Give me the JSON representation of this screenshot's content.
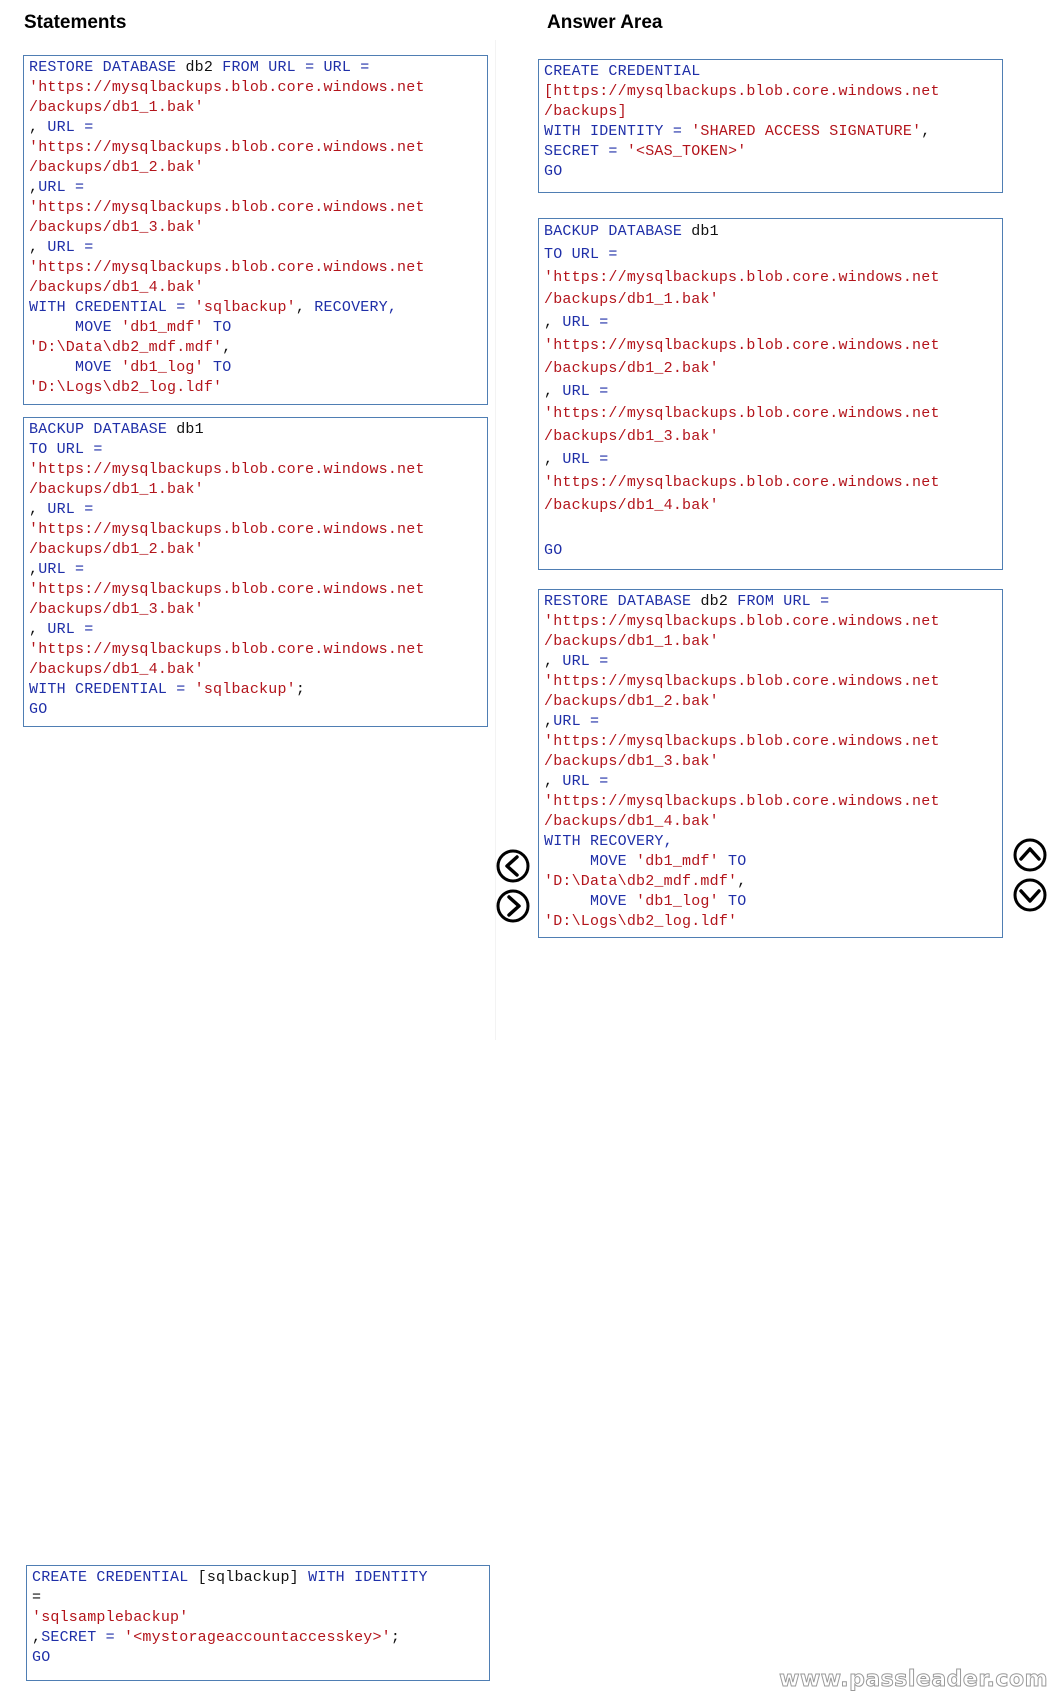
{
  "statements": {
    "title": "Statements",
    "items": [
      {
        "id": "restore-with-credential",
        "lines": [
          [
            [
              "kw",
              "RESTORE DATABASE "
            ],
            [
              "plain",
              "db2 "
            ],
            [
              "kw",
              "FROM URL = URL ="
            ]
          ],
          [
            [
              "str",
              "'https://mysqlbackups.blob.core.windows.net"
            ]
          ],
          [
            [
              "str",
              "/backups/db1_1.bak'"
            ]
          ],
          [
            [
              "plain",
              ", "
            ],
            [
              "kw",
              "URL ="
            ]
          ],
          [
            [
              "str",
              "'https://mysqlbackups.blob.core.windows.net"
            ]
          ],
          [
            [
              "str",
              "/backups/db1_2.bak'"
            ]
          ],
          [
            [
              "plain",
              ","
            ],
            [
              "kw",
              "URL ="
            ]
          ],
          [
            [
              "str",
              "'https://mysqlbackups.blob.core.windows.net"
            ]
          ],
          [
            [
              "str",
              "/backups/db1_3.bak'"
            ]
          ],
          [
            [
              "plain",
              ", "
            ],
            [
              "kw",
              "URL ="
            ]
          ],
          [
            [
              "str",
              "'https://mysqlbackups.blob.core.windows.net"
            ]
          ],
          [
            [
              "str",
              "/backups/db1_4.bak'"
            ]
          ],
          [
            [
              "kw",
              "WITH CREDENTIAL = "
            ],
            [
              "str",
              "'sqlbackup'"
            ],
            [
              "plain",
              ", "
            ],
            [
              "kw",
              "RECOVERY,"
            ]
          ],
          [
            [
              "kw",
              "     MOVE "
            ],
            [
              "str",
              "'db1_mdf' "
            ],
            [
              "kw",
              "TO"
            ]
          ],
          [
            [
              "str",
              "'D:\\Data\\db2_mdf.mdf'"
            ],
            [
              "plain",
              ","
            ]
          ],
          [
            [
              "kw",
              "     MOVE "
            ],
            [
              "str",
              "'db1_log' "
            ],
            [
              "kw",
              "TO"
            ]
          ],
          [
            [
              "str",
              "'D:\\Logs\\db2_log.ldf'"
            ]
          ]
        ]
      },
      {
        "id": "backup-with-credential",
        "lines": [
          [
            [
              "kw",
              "BACKUP DATABASE "
            ],
            [
              "plain",
              "db1"
            ]
          ],
          [
            [
              "kw",
              "TO URL ="
            ]
          ],
          [
            [
              "str",
              "'https://mysqlbackups.blob.core.windows.net"
            ]
          ],
          [
            [
              "str",
              "/backups/db1_1.bak'"
            ]
          ],
          [
            [
              "plain",
              ", "
            ],
            [
              "kw",
              "URL ="
            ]
          ],
          [
            [
              "str",
              "'https://mysqlbackups.blob.core.windows.net"
            ]
          ],
          [
            [
              "str",
              "/backups/db1_2.bak'"
            ]
          ],
          [
            [
              "plain",
              ","
            ],
            [
              "kw",
              "URL ="
            ]
          ],
          [
            [
              "str",
              "'https://mysqlbackups.blob.core.windows.net"
            ]
          ],
          [
            [
              "str",
              "/backups/db1_3.bak'"
            ]
          ],
          [
            [
              "plain",
              ", "
            ],
            [
              "kw",
              "URL ="
            ]
          ],
          [
            [
              "str",
              "'https://mysqlbackups.blob.core.windows.net"
            ]
          ],
          [
            [
              "str",
              "/backups/db1_4.bak'"
            ]
          ],
          [
            [
              "kw",
              "WITH CREDENTIAL = "
            ],
            [
              "str",
              "'sqlbackup'"
            ],
            [
              "plain",
              ";"
            ]
          ],
          [
            [
              "kw",
              "GO"
            ]
          ]
        ]
      },
      {
        "id": "create-credential-key",
        "lines": [
          [
            [
              "kw",
              "CREATE CREDENTIAL "
            ],
            [
              "plain",
              "[sqlbackup] "
            ],
            [
              "kw",
              "WITH IDENTITY"
            ]
          ],
          [
            [
              "plain",
              "="
            ]
          ],
          [
            [
              "str",
              "'sqlsamplebackup'"
            ]
          ],
          [
            [
              "plain",
              ","
            ],
            [
              "kw",
              "SECRET = "
            ],
            [
              "str",
              "'<mystorageaccountaccesskey>'"
            ],
            [
              "plain",
              ";"
            ]
          ],
          [
            [
              "kw",
              "GO"
            ]
          ]
        ]
      }
    ]
  },
  "answer_area": {
    "title": "Answer Area",
    "items": [
      {
        "id": "create-credential-sas",
        "lines": [
          [
            [
              "kw",
              "CREATE CREDENTIAL"
            ]
          ],
          [
            [
              "str",
              "[https://mysqlbackups.blob.core.windows.net"
            ]
          ],
          [
            [
              "str",
              "/backups]"
            ]
          ],
          [
            [
              "kw",
              "WITH IDENTITY = "
            ],
            [
              "str",
              "'SHARED ACCESS SIGNATURE'"
            ],
            [
              "plain",
              ","
            ]
          ],
          [
            [
              "kw",
              "SECRET = "
            ],
            [
              "str",
              "'<SAS_TOKEN>'"
            ]
          ],
          [
            [
              "kw",
              "GO"
            ]
          ]
        ]
      },
      {
        "id": "backup-sas",
        "lines": [
          [
            [
              "kw",
              "BACKUP DATABASE "
            ],
            [
              "plain",
              "db1"
            ]
          ],
          [
            [
              "kw",
              "TO URL ="
            ]
          ],
          [
            [
              "str",
              "'https://mysqlbackups.blob.core.windows.net"
            ]
          ],
          [
            [
              "str",
              "/backups/db1_1.bak'"
            ]
          ],
          [
            [
              "plain",
              ", "
            ],
            [
              "kw",
              "URL ="
            ]
          ],
          [
            [
              "str",
              "'https://mysqlbackups.blob.core.windows.net"
            ]
          ],
          [
            [
              "str",
              "/backups/db1_2.bak'"
            ]
          ],
          [
            [
              "plain",
              ", "
            ],
            [
              "kw",
              "URL ="
            ]
          ],
          [
            [
              "str",
              "'https://mysqlbackups.blob.core.windows.net"
            ]
          ],
          [
            [
              "str",
              "/backups/db1_3.bak'"
            ]
          ],
          [
            [
              "plain",
              ", "
            ],
            [
              "kw",
              "URL ="
            ]
          ],
          [
            [
              "str",
              "'https://mysqlbackups.blob.core.windows.net"
            ]
          ],
          [
            [
              "str",
              "/backups/db1_4.bak'"
            ]
          ],
          [
            [
              "plain",
              " "
            ]
          ],
          [
            [
              "kw",
              "GO"
            ]
          ]
        ]
      },
      {
        "id": "restore-sas",
        "lines": [
          [
            [
              "kw",
              "RESTORE DATABASE "
            ],
            [
              "plain",
              "db2 "
            ],
            [
              "kw",
              "FROM URL ="
            ]
          ],
          [
            [
              "str",
              "'https://mysqlbackups.blob.core.windows.net"
            ]
          ],
          [
            [
              "str",
              "/backups/db1_1.bak'"
            ]
          ],
          [
            [
              "plain",
              ", "
            ],
            [
              "kw",
              "URL ="
            ]
          ],
          [
            [
              "str",
              "'https://mysqlbackups.blob.core.windows.net"
            ]
          ],
          [
            [
              "str",
              "/backups/db1_2.bak'"
            ]
          ],
          [
            [
              "plain",
              ","
            ],
            [
              "kw",
              "URL ="
            ]
          ],
          [
            [
              "str",
              "'https://mysqlbackups.blob.core.windows.net"
            ]
          ],
          [
            [
              "str",
              "/backups/db1_3.bak'"
            ]
          ],
          [
            [
              "plain",
              ", "
            ],
            [
              "kw",
              "URL ="
            ]
          ],
          [
            [
              "str",
              "'https://mysqlbackups.blob.core.windows.net"
            ]
          ],
          [
            [
              "str",
              "/backups/db1_4.bak'"
            ]
          ],
          [
            [
              "kw",
              "WITH RECOVERY,"
            ]
          ],
          [
            [
              "kw",
              "     MOVE "
            ],
            [
              "str",
              "'db1_mdf' "
            ],
            [
              "kw",
              "TO"
            ]
          ],
          [
            [
              "str",
              "'D:\\Data\\db2_mdf.mdf'"
            ],
            [
              "plain",
              ","
            ]
          ],
          [
            [
              "kw",
              "     MOVE "
            ],
            [
              "str",
              "'db1_log' "
            ],
            [
              "kw",
              "TO"
            ]
          ],
          [
            [
              "str",
              "'D:\\Logs\\db2_log.ldf'"
            ]
          ]
        ]
      }
    ]
  },
  "controls": {
    "move_left": "move-left-icon",
    "move_right": "move-right-icon",
    "move_up": "move-up-icon",
    "move_down": "move-down-icon"
  },
  "colors": {
    "keyword": "#1f2fa8",
    "string": "#b3141b",
    "box_border": "#4f7eb3"
  },
  "watermark": "www.passleader.com"
}
